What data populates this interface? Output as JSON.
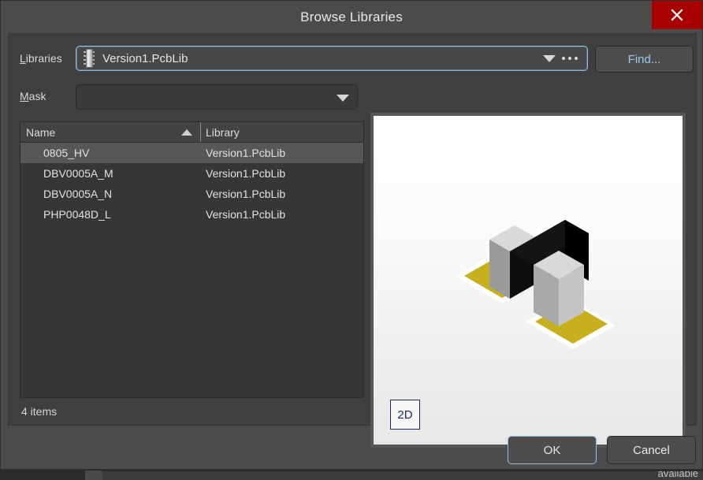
{
  "window": {
    "title": "Browse Libraries",
    "close_icon": "close-icon",
    "close_color": "#a80000"
  },
  "form": {
    "libraries_label": "Libraries",
    "libraries_label_mnemonic": "L",
    "libraries_value": "Version1.PcbLib",
    "libraries_icon": "pcb-library-chip-icon",
    "mask_label": "Mask",
    "mask_label_mnemonic": "M",
    "mask_value": "",
    "mask_placeholder": "",
    "find_button": "Find...",
    "dropdown_icon": "chevron-down-icon",
    "ellipsis_icon": "ellipsis-icon"
  },
  "list": {
    "columns": [
      "Name",
      "Library"
    ],
    "sort_column": "Name",
    "sort_direction": "ascending",
    "sort_icon": "sort-ascending-icon",
    "rows": [
      {
        "name": "0805_HV",
        "library": "Version1.PcbLib",
        "selected": true
      },
      {
        "name": "DBV0005A_M",
        "library": "Version1.PcbLib",
        "selected": false
      },
      {
        "name": "DBV0005A_N",
        "library": "Version1.PcbLib",
        "selected": false
      },
      {
        "name": "PHP0048D_L",
        "library": "Version1.PcbLib",
        "selected": false
      }
    ],
    "status": "4 items"
  },
  "preview": {
    "view_mode_button": "2D",
    "model_description": "0805 chip component 3D model",
    "body_color": "#0d0d0d",
    "terminal_color": "#a8a8a8",
    "pad_color": "#c8af1e",
    "mask_color": "#ffffff"
  },
  "footer": {
    "ok_label": "OK",
    "cancel_label": "Cancel"
  },
  "background": {
    "clipped_text": "available"
  },
  "colors": {
    "dialog_bg": "#4b4b4b",
    "panel_bg": "#3f3f3f",
    "field_bg": "#3a3a3a",
    "list_bg": "#363636",
    "accent_focus": "#8cc0e8",
    "link_text": "#9fc8ea",
    "selection": "#575757"
  }
}
